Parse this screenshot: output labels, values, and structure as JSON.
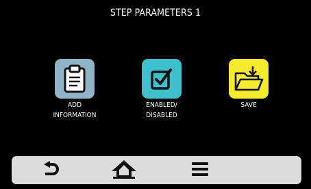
{
  "header": {
    "title": "STEP PARAMETERS 1"
  },
  "tiles": [
    {
      "label": "ADD\nINFORMATION",
      "icon": "clipboard-icon",
      "color": "#8fb4c8"
    },
    {
      "label": "ENABLED/\nDISABLED",
      "icon": "checkbox-icon",
      "color": "#3ec1cc"
    },
    {
      "label": "SAVE",
      "icon": "folder-save-icon",
      "color": "#f6ea2c"
    }
  ],
  "nav": [
    {
      "icon": "back-arrow-icon"
    },
    {
      "icon": "home-icon"
    },
    {
      "icon": "menu-icon"
    }
  ]
}
